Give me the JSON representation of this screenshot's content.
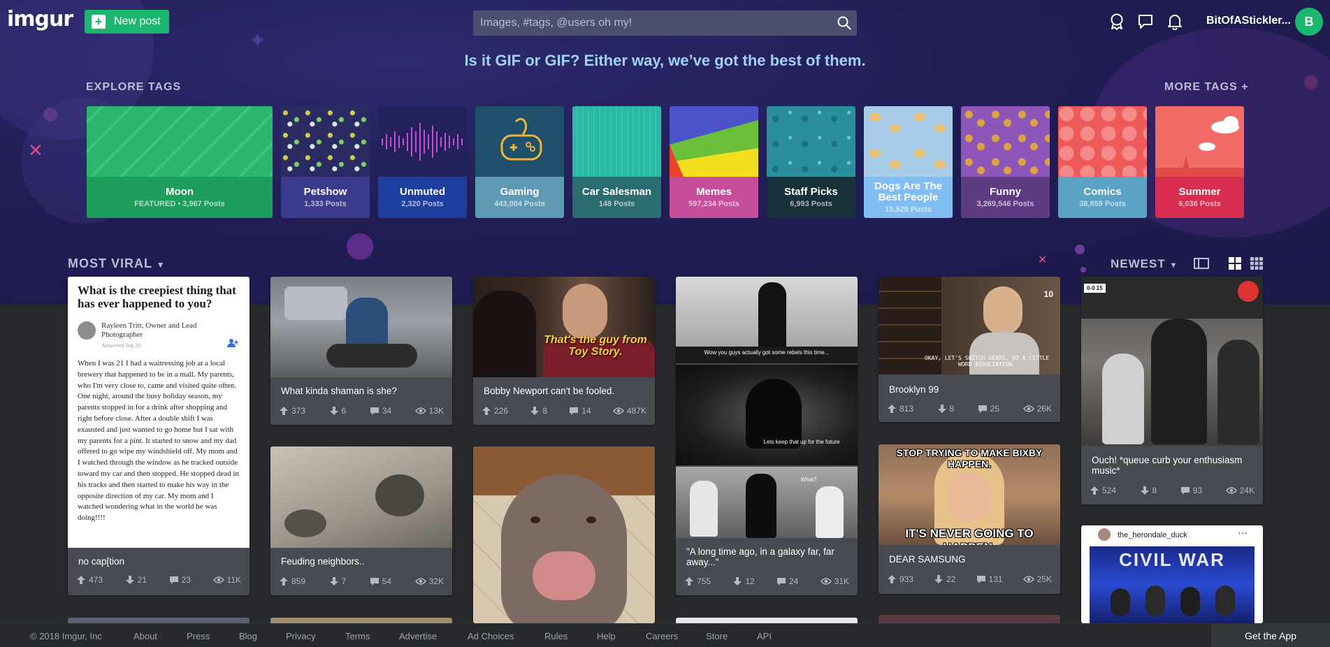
{
  "header": {
    "logo": "imgur",
    "new_post_label": "New post",
    "search_placeholder": "Images, #tags, @users oh my!",
    "username": "BitOfAStickler...",
    "avatar_letter": "B"
  },
  "tagline": "Is it GIF or GIF? Either way, we’ve got the best of them.",
  "explore": {
    "label": "EXPLORE TAGS",
    "more_label": "MORE TAGS +",
    "tags": [
      {
        "name": "Moon",
        "count": "FEATURED • 3,967 Posts",
        "color": "#1e9e5c",
        "art": "#2bb56d"
      },
      {
        "name": "Petshow",
        "count": "1,333 Posts",
        "color": "#3c3a8c",
        "art": "#2b2b63"
      },
      {
        "name": "Unmuted",
        "count": "2,320 Posts",
        "color": "#1f3fa0",
        "art": "#23215c"
      },
      {
        "name": "Gaming",
        "count": "443,004 Posts",
        "color": "#5f9ab4",
        "art": "#1f4f6a"
      },
      {
        "name": "Car Salesman",
        "count": "148 Posts",
        "color": "#2b6c70",
        "art": "#2bb9a6"
      },
      {
        "name": "Memes",
        "count": "597,234 Posts",
        "color": "#c54d9c",
        "art": "#4b53c9"
      },
      {
        "name": "Staff Picks",
        "count": "6,993 Posts",
        "color": "#163138",
        "art": "#2b8f9b"
      },
      {
        "name": "Dogs Are The Best People",
        "count": "15,528 Posts",
        "color": "#7fbdf2",
        "art": "#a7cde8"
      },
      {
        "name": "Funny",
        "count": "3,269,546 Posts",
        "color": "#5f3b84",
        "art": "#8e56b8"
      },
      {
        "name": "Comics",
        "count": "38,859 Posts",
        "color": "#5ba3c6",
        "art": "#ee5a5a"
      },
      {
        "name": "Summer",
        "count": "6,036 Posts",
        "color": "#d92d4f",
        "art": "#f26b66"
      }
    ]
  },
  "gallery": {
    "section_label": "MOST VIRAL",
    "sort_label": "NEWEST",
    "quora": {
      "question": "What is the creepiest thing that has ever happened to you?",
      "author": "Rayleen Tritt, Owner and Lead Photographer",
      "answered": "Answered Sep 20",
      "body": "When I was 21 I had a waitressing job at a local brewery that happened to be in a mall. My parents, who I'm very close to, came and visited quite often. One night, around the busy holiday season, my parents stopped in for a drink after shopping and right before close. After a double shift I was exausted and just wanted to go home but I sat with my parents for a pint. It started to snow and my dad offered to go wipe my windshield off. My mom and I watched through the window as he tracked outside toward my car and then stopped. He stopped dead in his tracks and then started to make his way in the opposite direction of my car. My mom and I watched wondering what in the world he was doing!!!!"
    },
    "posts": [
      {
        "title": "no cap[tion",
        "up": "473",
        "down": "21",
        "comments": "23",
        "views": "11K"
      },
      {
        "title": "What kinda shaman is she?",
        "up": "373",
        "down": "6",
        "comments": "34",
        "views": "13K"
      },
      {
        "title": "Feuding neighbors..",
        "up": "859",
        "down": "7",
        "comments": "54",
        "views": "32K"
      },
      {
        "title": "Bobby Newport can't be fooled.",
        "up": "226",
        "down": "8",
        "comments": "14",
        "views": "487K",
        "caption": "That's the guy from Toy Story."
      },
      {
        "title": "\"A long time ago, in a galaxy far, far away...\"",
        "up": "755",
        "down": "12",
        "comments": "24",
        "views": "31K",
        "subs": [
          "Wow you guys actually got some rebels this time...",
          "Lets keep that up for the future",
          "What?"
        ]
      },
      {
        "title": "Brooklyn 99",
        "up": "813",
        "down": "8",
        "comments": "25",
        "views": "26K",
        "badge": "10",
        "sub": "OKAY, LET'S SWITCH GEARS, DO A LITTLE WORD ASSOCIATION."
      },
      {
        "title": "DEAR SAMSUNG",
        "up": "933",
        "down": "22",
        "comments": "131",
        "views": "25K",
        "top_text": "STOP TRYING TO MAKE BIXBY HAPPEN.",
        "bottom_text": "IT'S NEVER GOING TO HAPPEN."
      },
      {
        "title": "Ouch! *queue curb your enthusiasm music*",
        "up": "524",
        "down": "8",
        "comments": "93",
        "views": "24K",
        "score": "0-0 15"
      },
      {
        "insta_user": "the_herondale_duck",
        "insta_banner": "CIVIL WAR"
      }
    ]
  },
  "footer": {
    "copyright": "© 2018 Imgur, Inc",
    "links": [
      "About",
      "Press",
      "Blog",
      "Privacy",
      "Terms",
      "Advertise",
      "Ad Choices",
      "Rules",
      "Help",
      "Careers",
      "Store",
      "API"
    ],
    "get_app": "Get the App"
  }
}
